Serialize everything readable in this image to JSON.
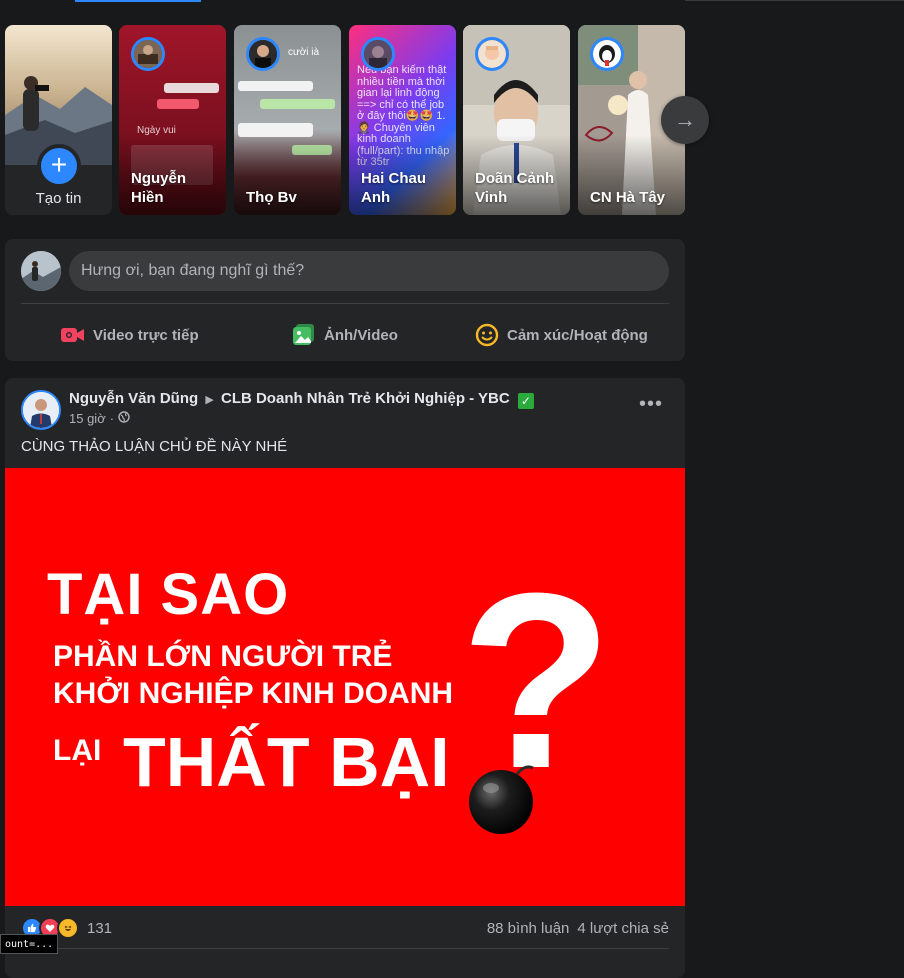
{
  "stories": {
    "create": {
      "label": "Tạo tin",
      "plus_icon": "+"
    },
    "items": [
      {
        "name": "Nguyễn Hiền",
        "accent": "#8b0f1d"
      },
      {
        "name": "Thọ Bv",
        "accent": "#5a1f24"
      },
      {
        "name": "Hai Chau Anh",
        "accent": "#6d3dd8"
      },
      {
        "name": "Doãn Cảnh Vinh",
        "accent": "#c9c2b4"
      },
      {
        "name": "CN Hà Tây",
        "accent": "#b79b85"
      }
    ],
    "story2_overlay_text": "cười ià",
    "story3_text": "Nếu bạn kiếm thật nhiều tiền mà thời gian lại linh động ==> chỉ có thể job ở đây thôi🤩🤩 1. 🤵 Chuyên viên kinh doanh (full/part): thu nhập từ 35tr",
    "next_icon": "→"
  },
  "composer": {
    "placeholder": "Hưng ơi, bạn đang nghĩ gì thế?",
    "actions": [
      {
        "label": "Video trực tiếp",
        "color": "#f3425f"
      },
      {
        "label": "Ảnh/Video",
        "color": "#45bd62"
      },
      {
        "label": "Cảm xúc/Hoạt động",
        "color": "#f7b928"
      }
    ]
  },
  "post": {
    "author": "Nguyễn Văn Dũng",
    "separator": "▶",
    "group": "CLB Doanh Nhân Trẻ Khởi Nghiệp - YBC",
    "verified_icon": "✓",
    "time": "15 giờ",
    "dot": "·",
    "more_icon": "•••",
    "caption": "CÙNG THẢO LUẬN CHỦ ĐỀ NÀY NHÉ",
    "image_text": {
      "line1": "TẠI SAO",
      "line2": "PHẦN LỚN NGƯỜI TRẺ",
      "line3": "KHỞI NGHIỆP KINH DOANH",
      "line4_small": "LẠI",
      "line4_big": "THẤT BẠI",
      "question": "?"
    },
    "reaction_count": "131",
    "comments": "88 bình luận",
    "shares": "4 lượt chia sẻ"
  },
  "corner_tooltip": "ount=..."
}
